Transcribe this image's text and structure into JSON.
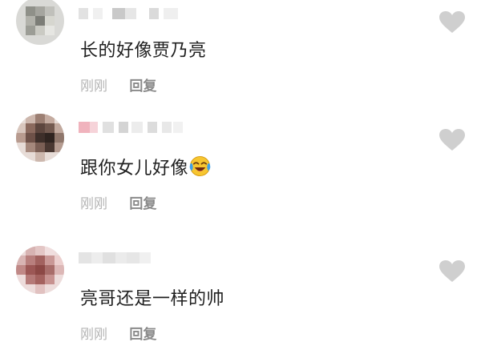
{
  "comments": [
    {
      "text": "长的好像贾乃亮",
      "time": "刚刚",
      "reply": "回复",
      "emoji": ""
    },
    {
      "text": "跟你女儿好像",
      "time": "刚刚",
      "reply": "回复",
      "emoji": "laughing-crying-emoji"
    },
    {
      "text": "亮哥还是一样的帅",
      "time": "刚刚",
      "reply": "回复",
      "emoji": ""
    }
  ],
  "icons": {
    "like": "heart-icon"
  },
  "colors": {
    "text": "#1f1f1f",
    "time": "#b4b4b4",
    "reply": "#8a8a8a",
    "heart": "#cfcfcf"
  }
}
